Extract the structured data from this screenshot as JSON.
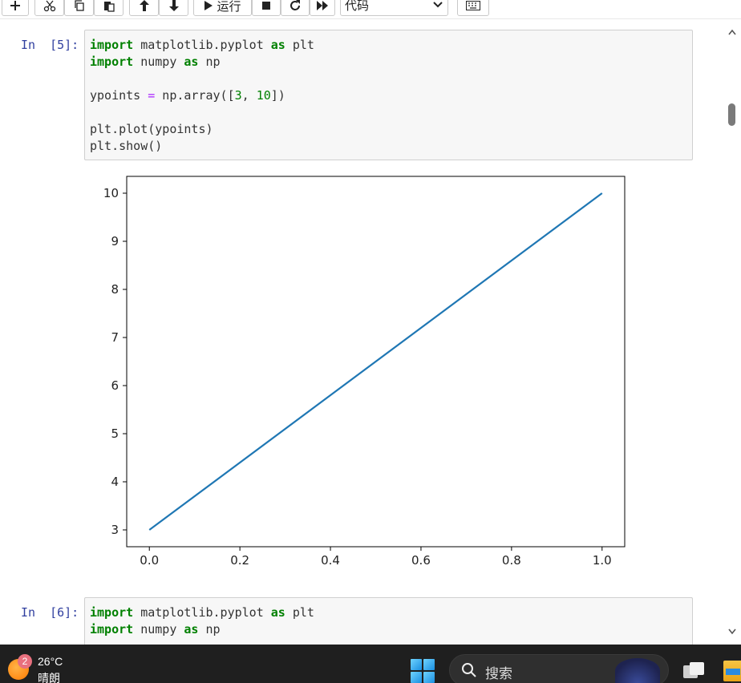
{
  "toolbar": {
    "run_label": "运行",
    "cell_type": "代码"
  },
  "cells": [
    {
      "prompt_label": "In",
      "prompt_num": "[5]:",
      "code_lines": [
        [
          "import",
          " matplotlib.pyplot ",
          "as",
          " plt"
        ],
        [
          "import",
          " numpy ",
          "as",
          " np"
        ]
      ],
      "line3": "ypoints = np.array([3, 10])",
      "line4": "plt.plot(ypoints)",
      "line5": "plt.show()"
    },
    {
      "prompt_label": "In",
      "prompt_num": "[6]:"
    }
  ],
  "chart_data": {
    "type": "line",
    "x": [
      0,
      1
    ],
    "series": [
      {
        "values": [
          3,
          10
        ],
        "color": "#1f77b4"
      }
    ],
    "xlim": [
      -0.05,
      1.05
    ],
    "ylim": [
      2.65,
      10.35
    ],
    "xticks": [
      "0.0",
      "0.2",
      "0.4",
      "0.6",
      "0.8",
      "1.0"
    ],
    "yticks": [
      "3",
      "4",
      "5",
      "6",
      "7",
      "8",
      "9",
      "10"
    ],
    "grid": false,
    "title": "",
    "xlabel": "",
    "ylabel": ""
  },
  "taskbar": {
    "weather_badge": "2",
    "temperature": "26°C",
    "condition": "晴朗",
    "search_placeholder": "搜索"
  }
}
